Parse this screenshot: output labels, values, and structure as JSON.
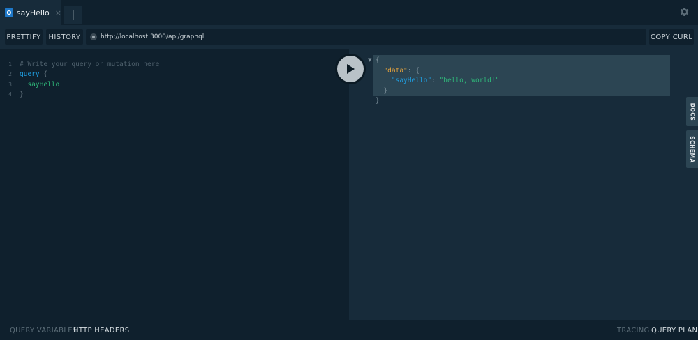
{
  "tabs": [
    {
      "badge": "Q",
      "title": "sayHello",
      "close": "×"
    }
  ],
  "tab_add_label": "+",
  "icons": {
    "settings": "gear-icon",
    "run": "play-icon",
    "close": "close-icon",
    "add": "plus-icon"
  },
  "toolbar": {
    "prettify_label": "PRETTIFY",
    "history_label": "HISTORY",
    "endpoint_url": "http://localhost:3000/api/graphql",
    "copy_curl_label": "COPY CURL"
  },
  "editor": {
    "lines": [
      {
        "number": "1",
        "text": "# Write your query or mutation here"
      },
      {
        "number": "2",
        "keyword": "query",
        "punc": " {"
      },
      {
        "number": "3",
        "field": "  sayHello"
      },
      {
        "number": "4",
        "punc": "}"
      }
    ]
  },
  "result": {
    "open_brace": "{",
    "data_key": "\"data\"",
    "data_sep": ": {",
    "field_key": "\"sayHello\"",
    "field_sep": ": ",
    "field_value": "\"hello, world!\"",
    "inner_close": "}",
    "outer_close": "}"
  },
  "side_tabs": {
    "docs_label": "DOCS",
    "schema_label": "SCHEMA"
  },
  "bottom": {
    "query_variables_label": "QUERY VARIABLES",
    "http_headers_label": "HTTP HEADERS",
    "tracing_label": "TRACING",
    "query_plan_label": "QUERY PLAN"
  },
  "colors": {
    "background": "#172b3a",
    "editor_background": "#0f202d",
    "keyword": "#1f9ee0",
    "field": "#2fb87a",
    "json_key": "#e8a43c",
    "badge": "#1e78c8"
  }
}
